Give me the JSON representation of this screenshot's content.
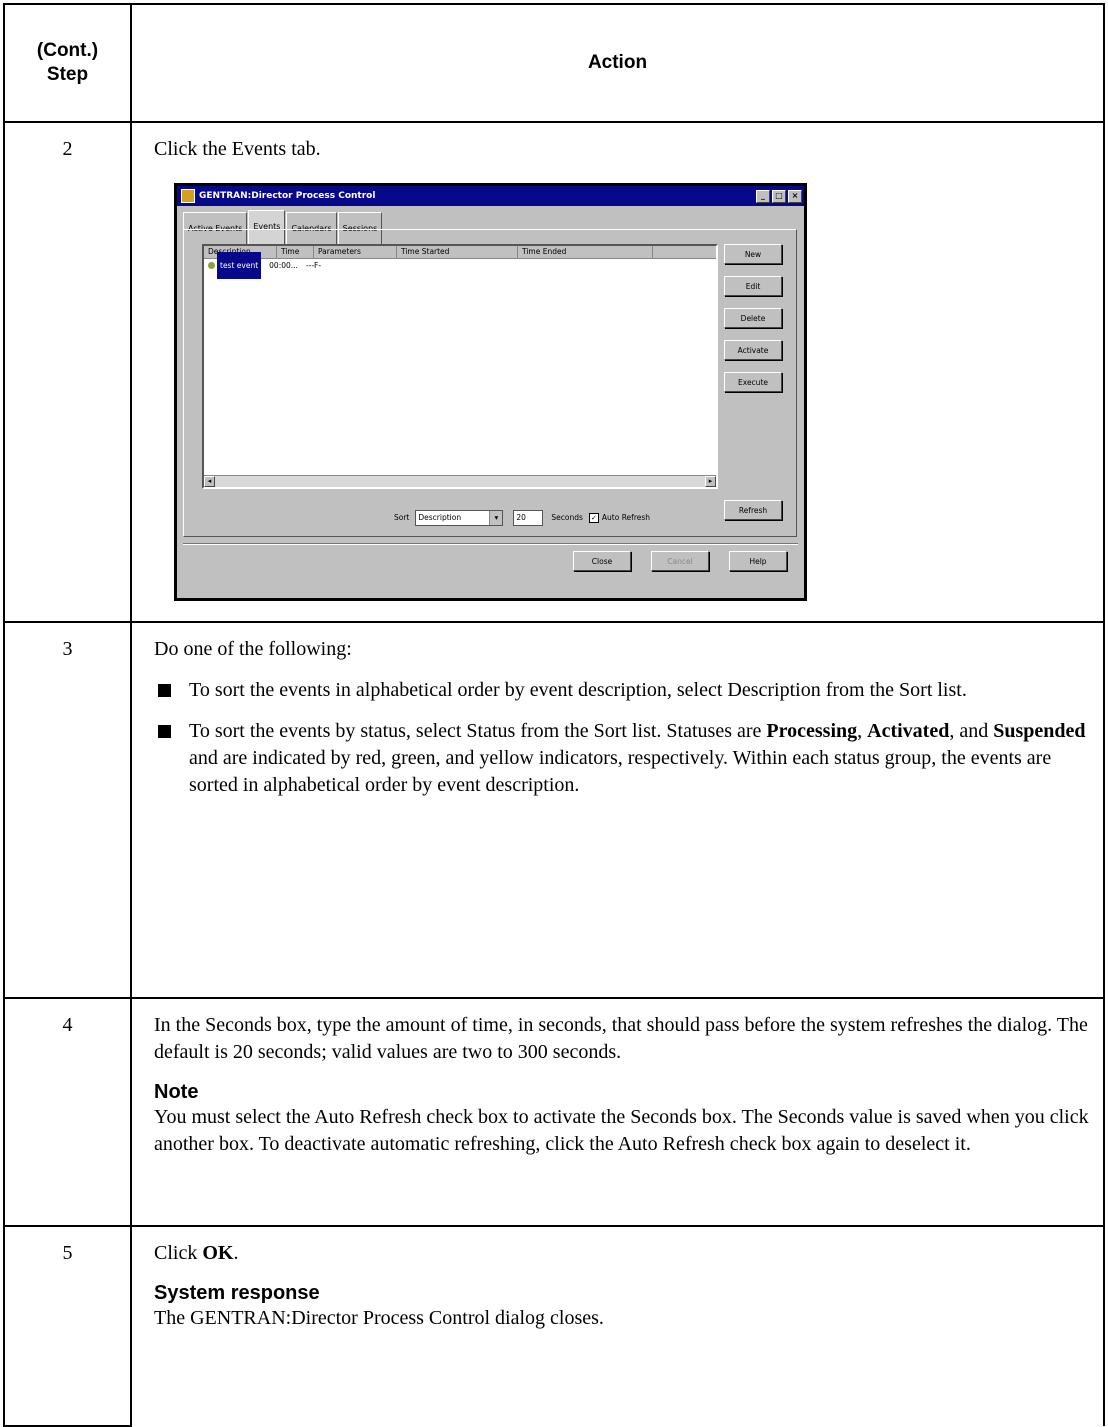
{
  "header": {
    "step_line1": "(Cont.)",
    "step_line2": "Step",
    "action": "Action"
  },
  "rows": [
    {
      "num": "2",
      "text": "Click the Events tab."
    },
    {
      "num": "3",
      "intro": "Do one of the following:",
      "bullet1": "To sort the events in alphabetical order by event description, select Description from the Sort list.",
      "bullet2_a": "To sort the events by status, select Status from the Sort list. Statuses are ",
      "bullet2_b1": "Processing",
      "bullet2_sep1": ", ",
      "bullet2_b2": "Activated",
      "bullet2_sep2": ", and ",
      "bullet2_b3": "Suspended",
      "bullet2_c": " and are indicated by red, green, and yellow indicators, respectively. Within each status group, the events are sorted in alphabetical order by event description."
    },
    {
      "num": "4",
      "text": "In the Seconds box, type the amount of time, in seconds, that should pass before the system refreshes the dialog. The default is 20 seconds; valid values are two to 300 seconds.",
      "note_heading": "Note",
      "note_text": "You must select the Auto Refresh check box to activate the Seconds box. The Seconds value is saved when you click another box. To deactivate automatic refreshing, click the Auto Refresh check box again to deselect it."
    },
    {
      "num": "5",
      "text_a": "Click ",
      "text_b": "OK",
      "text_c": ".",
      "resp_heading": "System response",
      "resp_text": "The GENTRAN:Director Process Control dialog closes."
    }
  ],
  "dialog": {
    "title": "GENTRAN:Director Process Control",
    "tabs": [
      "Active Events",
      "Events",
      "Calendars",
      "Sessions"
    ],
    "columns": [
      "Description",
      "Time",
      "Parameters",
      "Time Started",
      "Time Ended"
    ],
    "row": {
      "description": "test event",
      "time": "00:00...",
      "parameters": "---F-"
    },
    "side_buttons": [
      "New",
      "Edit",
      "Delete",
      "Activate",
      "Execute"
    ],
    "refresh_label": "Refresh",
    "sort_label": "Sort",
    "sort_value": "Description",
    "seconds_value": "20",
    "seconds_label": "Seconds",
    "auto_refresh_label": "Auto Refresh",
    "bottom_buttons": [
      "Close",
      "Cancel",
      "Help"
    ],
    "indicator_color": "#8aa03a",
    "title_color": "#08088a"
  }
}
